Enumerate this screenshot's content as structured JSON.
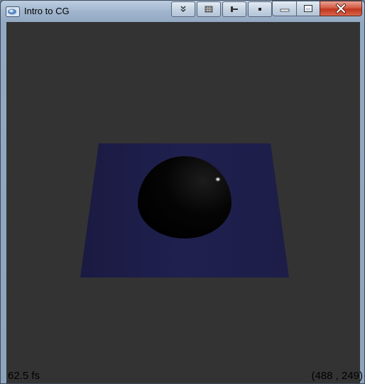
{
  "window": {
    "title": "Intro to CG",
    "icon": "app-icon",
    "controls": [
      "collapse-icon",
      "grid-icon",
      "pin-icon",
      "dot-icon",
      "minimize-icon",
      "maximize-icon",
      "close-icon"
    ]
  },
  "viewport": {
    "fps_label": "62.5 fs",
    "coords_label": "(488 , 249)",
    "background_color": "#333333",
    "plane_color": "#1c1c48",
    "sphere_color": "#000000"
  }
}
